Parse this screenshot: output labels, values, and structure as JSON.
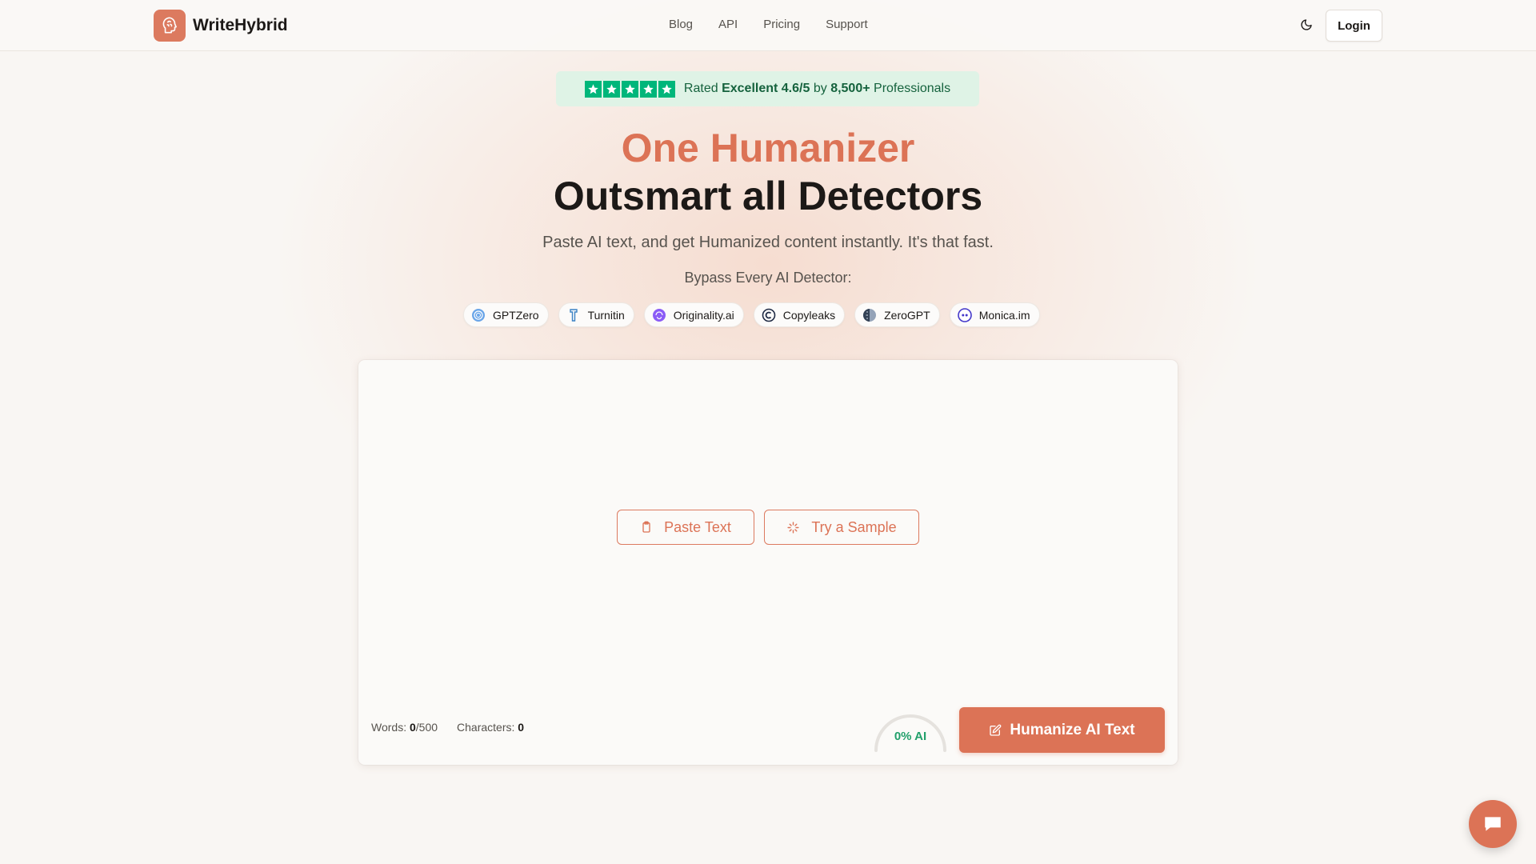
{
  "brand": {
    "name": "WriteHybrid",
    "logo_icon": "brain-head-icon"
  },
  "nav": {
    "items": [
      "Blog",
      "API",
      "Pricing",
      "Support"
    ]
  },
  "header": {
    "theme_icon": "moon-icon",
    "login_label": "Login"
  },
  "rating": {
    "stars": 5,
    "prefix": "Rated",
    "rating_text": "Excellent 4.6/5",
    "middle": "by",
    "count": "8,500+",
    "suffix": "Professionals"
  },
  "hero": {
    "line1": "One Humanizer",
    "line2": "Outsmart all Detectors",
    "subtitle": "Paste AI text, and get Humanized content instantly. It's that fast.",
    "bypass_label": "Bypass Every AI Detector:"
  },
  "detectors": [
    {
      "name": "GPTZero",
      "icon": "gptzero-icon"
    },
    {
      "name": "Turnitin",
      "icon": "turnitin-icon"
    },
    {
      "name": "Originality.ai",
      "icon": "originality-icon"
    },
    {
      "name": "Copyleaks",
      "icon": "copyleaks-icon"
    },
    {
      "name": "ZeroGPT",
      "icon": "zerogpt-icon"
    },
    {
      "name": "Monica.im",
      "icon": "monica-icon"
    }
  ],
  "editor": {
    "paste_label": "Paste Text",
    "sample_label": "Try a Sample",
    "words_label": "Words:",
    "words_value": "0",
    "words_limit": "/500",
    "chars_label": "Characters:",
    "chars_value": "0",
    "ai_score": "0% AI",
    "humanize_label": "Humanize AI Text"
  },
  "colors": {
    "accent": "#dc7356",
    "trustpilot_green": "#00b67a",
    "ai_score_green": "#22a06b"
  },
  "chat": {
    "icon": "chat-bubble-icon"
  }
}
